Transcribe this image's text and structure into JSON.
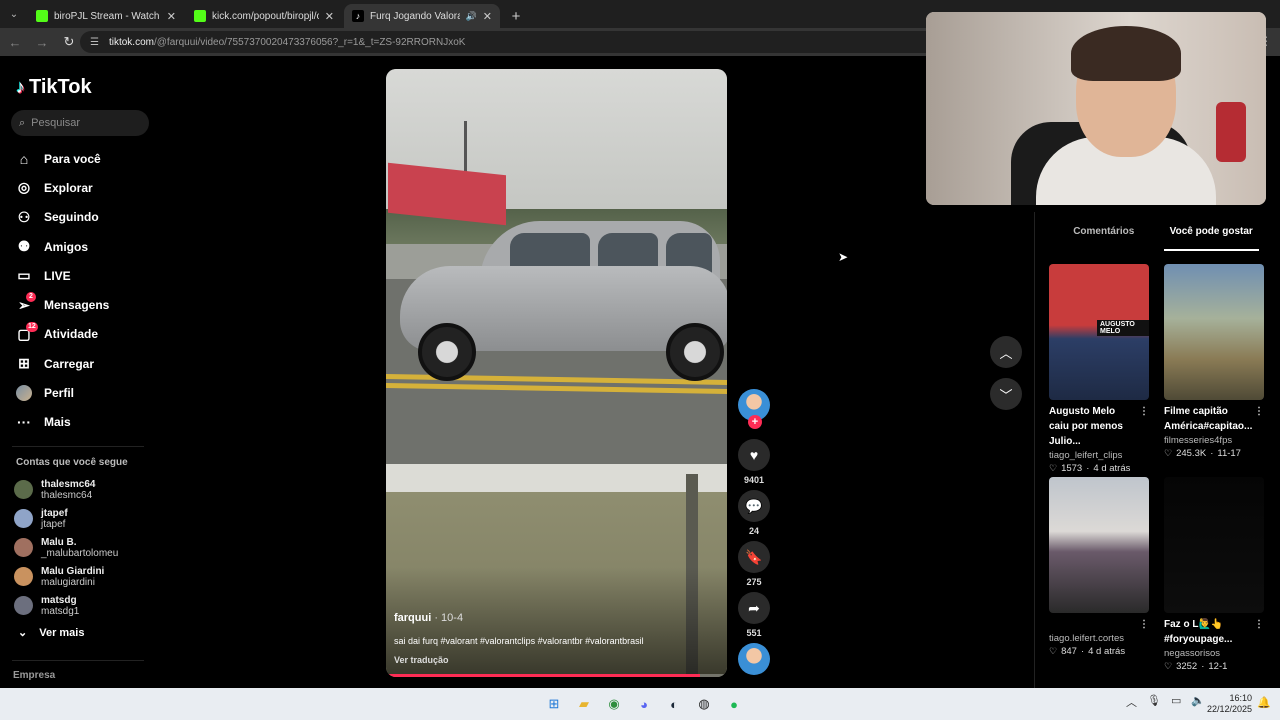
{
  "browser": {
    "tabs": [
      {
        "title": "biroPJL Stream - Watch Live on",
        "favicon_color": "#53fc18",
        "active": false,
        "audio": false
      },
      {
        "title": "kick.com/popout/biropjl/chat",
        "favicon_color": "#53fc18",
        "active": false,
        "audio": false
      },
      {
        "title": "Furq Jogando Valorant no",
        "favicon_color": "#ffffff",
        "active": true,
        "audio": true
      }
    ],
    "url_host": "tiktok.com",
    "url_path": "/@farquui/video/7557370020473376056?_r=1&_t=ZS-92RRORNJxoK"
  },
  "sidebar": {
    "logo": "TikTok",
    "search_placeholder": "Pesquisar",
    "menu": [
      {
        "label": "Para você",
        "icon": "home-icon",
        "glyph": "⌂",
        "badge": ""
      },
      {
        "label": "Explorar",
        "icon": "compass-icon",
        "glyph": "◎",
        "badge": ""
      },
      {
        "label": "Seguindo",
        "icon": "following-icon",
        "glyph": "⚇",
        "badge": ""
      },
      {
        "label": "Amigos",
        "icon": "friends-icon",
        "glyph": "⚉",
        "badge": ""
      },
      {
        "label": "LIVE",
        "icon": "live-icon",
        "glyph": "▭",
        "badge": ""
      },
      {
        "label": "Mensagens",
        "icon": "messages-icon",
        "glyph": "➢",
        "badge": "2"
      },
      {
        "label": "Atividade",
        "icon": "activity-icon",
        "glyph": "▢",
        "badge": "12"
      },
      {
        "label": "Carregar",
        "icon": "upload-icon",
        "glyph": "⊞",
        "badge": ""
      },
      {
        "label": "Perfil",
        "icon": "profile-avatar",
        "glyph": "",
        "badge": ""
      },
      {
        "label": "Mais",
        "icon": "more-icon",
        "glyph": "···",
        "badge": ""
      }
    ],
    "following_title": "Contas que você segue",
    "following": [
      {
        "name": "thalesmc64",
        "handle": "thalesmc64",
        "color": "#5b6b4a"
      },
      {
        "name": "jtapef",
        "handle": "jtapef",
        "color": "#8fa4c8"
      },
      {
        "name": "Malu B.",
        "handle": "_malubartolomeu",
        "color": "#a07060"
      },
      {
        "name": "Malu Giardini",
        "handle": "malugiardini",
        "color": "#c9925f"
      },
      {
        "name": "matsdg",
        "handle": "matsdg1",
        "color": "#6c6f7e"
      }
    ],
    "see_more": "Ver mais",
    "company": "Empresa"
  },
  "video": {
    "author": "farquui",
    "date": " · 10-4",
    "description": "sai dai furq #valorant #valorantclips #valorantbr #valorantbrasil",
    "translate": "Ver tradução",
    "progress": 0.92
  },
  "actions": {
    "likes": "9401",
    "comments": "24",
    "saves": "275",
    "shares": "551"
  },
  "right_panel": {
    "tabs": [
      "Comentários",
      "Você pode gostar"
    ],
    "active_tab": 1,
    "cards": [
      {
        "title": "Augusto Melo caiu por menos Julio...",
        "author": "tiago_leifert_clips",
        "likes": "1573",
        "age": "4 d atrás",
        "thumb": "linear-gradient(#c83c3c 0%, #c83c3c 45%, #2c3e66 55%, #1e2a44 100%)",
        "thumb_text": "AUGUSTO MELO"
      },
      {
        "title": "Filme capitão América#capitao...",
        "author": "filmesseries4fps",
        "likes": "245.3K",
        "age": "11-17",
        "thumb": "linear-gradient(#6f8fb2 0%, #a6b19a 40%, #8a7b55 70%, #4f4a36 100%)",
        "thumb_text": ""
      },
      {
        "title": "",
        "author": "tiago.leifert.cortes",
        "likes": "847",
        "age": "4 d atrás",
        "thumb": "linear-gradient(#bfc5cc 0%, #dcd9d6 40%, #6a5a6a 55%, #2a2a2a 100%)",
        "thumb_text": ""
      },
      {
        "title": "Faz o L🙋‍♂️👆 #foryoupage...",
        "author": "negassorisos",
        "likes": "3252",
        "age": "12-1",
        "thumb": "linear-gradient(#050505, #0d0d0d)",
        "thumb_text": ""
      }
    ]
  },
  "taskbar": {
    "time": "16:10",
    "date": "22/12/2025"
  }
}
